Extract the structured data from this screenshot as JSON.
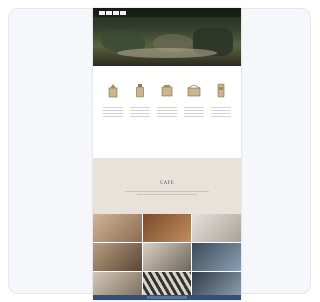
{
  "preview": {
    "nav": {
      "logo_text": "",
      "links": [
        "",
        "",
        "",
        ""
      ]
    },
    "features": [
      {
        "icon": "coffee-grinder-icon",
        "title": ""
      },
      {
        "icon": "bottle-icon",
        "title": ""
      },
      {
        "icon": "box-icon",
        "title": ""
      },
      {
        "icon": "box-icon",
        "title": ""
      },
      {
        "icon": "bottle-icon",
        "title": ""
      }
    ],
    "section2": {
      "title": "CAFE"
    },
    "colors": {
      "hero_dark": "#1f2a1e",
      "section_bg": "#e7e3db",
      "footer": "#2f4f7f"
    }
  }
}
